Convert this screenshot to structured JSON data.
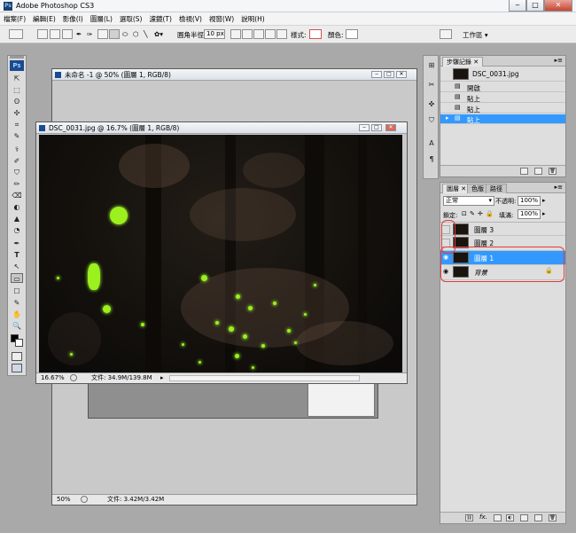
{
  "app": {
    "title": "Adobe Photoshop CS3",
    "icon_text": "Ps"
  },
  "menu": {
    "items": [
      "檔案(F)",
      "編輯(E)",
      "影像(I)",
      "圖層(L)",
      "選取(S)",
      "濾鏡(T)",
      "檢視(V)",
      "視窗(W)",
      "說明(H)"
    ]
  },
  "options": {
    "radius_label": "圓角半徑:",
    "radius_value": "10 px",
    "style_label": "樣式:",
    "color_label": "顏色:",
    "workspace_label": "工作區 ▾"
  },
  "toolbox": {
    "logo": "Ps",
    "tools": [
      "⇱",
      "⬚",
      "ʘ",
      "✣",
      "⌗",
      "✎",
      "⚕",
      "✐",
      "⛉",
      "✏",
      "⌫",
      "◐",
      "▲",
      "◔",
      "✒",
      "T",
      "↖",
      "▭",
      "☐",
      "✎",
      "✋",
      "🔍"
    ]
  },
  "doc_back": {
    "title": "未命名 -1 @ 50% (圖層 1, RGB/8)",
    "zoom": "50%",
    "file_info": "文件: 3.42M/3.42M"
  },
  "doc_front": {
    "title": "DSC_0031.jpg @ 16.7% (圖層 1, RGB/8)",
    "zoom": "16.67%",
    "file_info": "文件: 34.9M/139.8M"
  },
  "history": {
    "tab_label": "步驟記錄",
    "snapshot_name": "DSC_0031.jpg",
    "steps": [
      "開啟",
      "貼上",
      "貼上",
      "貼上"
    ],
    "selected_index": 3
  },
  "layers": {
    "tabs": [
      "圖層",
      "色版",
      "路徑"
    ],
    "blend_mode": "正常",
    "opacity_label": "不透明:",
    "opacity_value": "100%",
    "lock_label": "鎖定:",
    "fill_label": "填滿:",
    "fill_value": "100%",
    "items": [
      {
        "name": "圖層 3",
        "visible": false,
        "selected": false
      },
      {
        "name": "圖層 2",
        "visible": false,
        "selected": false
      },
      {
        "name": "圖層 1",
        "visible": true,
        "selected": true
      },
      {
        "name": "背景",
        "visible": true,
        "selected": false,
        "locked": true
      }
    ],
    "highlight_color": "#e23a3a"
  }
}
